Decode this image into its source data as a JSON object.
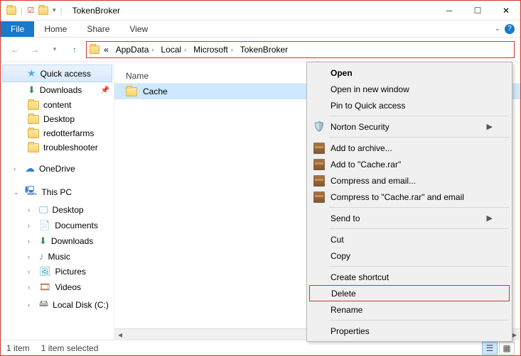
{
  "titlebar": {
    "title": "TokenBroker"
  },
  "ribbon": {
    "file": "File",
    "tabs": [
      "Home",
      "Share",
      "View"
    ]
  },
  "breadcrumb": {
    "prefix": "«",
    "items": [
      "AppData",
      "Local",
      "Microsoft",
      "TokenBroker"
    ]
  },
  "columns": {
    "name": "Name"
  },
  "files": [
    {
      "name": "Cache",
      "selected": true
    }
  ],
  "nav": {
    "quick_access": "Quick access",
    "quick_items": [
      {
        "label": "Downloads",
        "icon": "dl",
        "pinned": true
      },
      {
        "label": "content",
        "icon": "folder"
      },
      {
        "label": "Desktop",
        "icon": "folder"
      },
      {
        "label": "redotterfarms",
        "icon": "folder"
      },
      {
        "label": "troubleshooter",
        "icon": "folder"
      }
    ],
    "onedrive": "OneDrive",
    "this_pc": "This PC",
    "pc_items": [
      {
        "label": "Desktop",
        "icon": "desktop"
      },
      {
        "label": "Documents",
        "icon": "doc"
      },
      {
        "label": "Downloads",
        "icon": "dl"
      },
      {
        "label": "Music",
        "icon": "music"
      },
      {
        "label": "Pictures",
        "icon": "pic"
      },
      {
        "label": "Videos",
        "icon": "video"
      },
      {
        "label": "Local Disk (C:)",
        "icon": "disk"
      }
    ]
  },
  "context_menu": {
    "open": "Open",
    "open_new": "Open in new window",
    "pin_qa": "Pin to Quick access",
    "norton": "Norton Security",
    "add_archive": "Add to archive...",
    "add_cache": "Add to \"Cache.rar\"",
    "compress_email": "Compress and email...",
    "compress_cache_email": "Compress to \"Cache.rar\" and email",
    "send_to": "Send to",
    "cut": "Cut",
    "copy": "Copy",
    "shortcut": "Create shortcut",
    "delete": "Delete",
    "rename": "Rename",
    "properties": "Properties"
  },
  "status": {
    "count": "1 item",
    "selected": "1 item selected"
  }
}
